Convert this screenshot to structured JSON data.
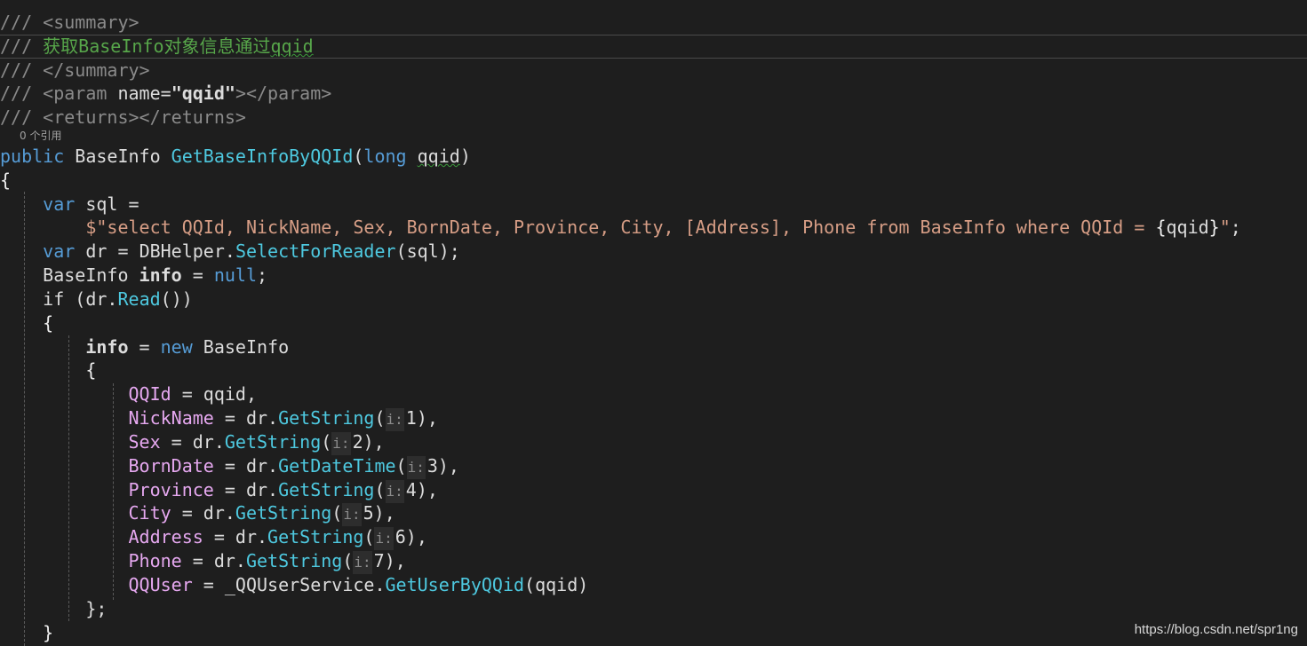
{
  "codelens": "0 个引用",
  "doc": {
    "slashes": "///",
    "summary_open": "<summary>",
    "summary_text": "获取BaseInfo对象信息通过",
    "summary_param_word": "qqid",
    "summary_close": "</summary>",
    "param_open": "<param",
    "param_attr": "name=",
    "param_value": "\"qqid\"",
    "param_close": "></param>",
    "returns": "<returns></returns>"
  },
  "signature": {
    "modifier": "public",
    "return_type": "BaseInfo",
    "method": "GetBaseInfoByQQId",
    "open": "(",
    "param_type": "long",
    "param_name": "qqid",
    "close": ")"
  },
  "body": {
    "open_brace": "{",
    "close_brace": "}",
    "var": "var",
    "sql_var": "sql",
    "assign": " = ",
    "dollar": "$",
    "sql_string": "\"select QQId, NickName, Sex, BornDate, Province, City, [Address], Phone from BaseInfo where QQId = ",
    "interp_open": "{",
    "interp_var": "qqid",
    "interp_close": "}",
    "sql_end_quote": "\"",
    "semicolon": ";",
    "dr_var": "dr",
    "dbhelper": "DBHelper",
    "dot": ".",
    "select_reader": "SelectForReader",
    "sql_arg": "(sql);",
    "baseinfo_type": "BaseInfo",
    "info_var": "info",
    "null_kw": "null",
    "if_kw": "if",
    "if_open": " (dr.",
    "read_method": "Read",
    "if_close": "())",
    "new_kw": "new",
    "init_close": "};",
    "hint_label": "i:",
    "assignments": [
      {
        "prop": "QQId",
        "value": "qqid,"
      },
      {
        "prop": "NickName",
        "method": "GetString",
        "arg": "1"
      },
      {
        "prop": "Sex",
        "method": "GetString",
        "arg": "2"
      },
      {
        "prop": "BornDate",
        "method": "GetDateTime",
        "arg": "3"
      },
      {
        "prop": "Province",
        "method": "GetString",
        "arg": "4"
      },
      {
        "prop": "City",
        "method": "GetString",
        "arg": "5"
      },
      {
        "prop": "Address",
        "method": "GetString",
        "arg": "6"
      },
      {
        "prop": "Phone",
        "method": "GetString",
        "arg": "7"
      }
    ],
    "qquser": {
      "prop": "QQUser",
      "service": "_QQUserService",
      "method": "GetUserByQQid",
      "arg": "(qqid)"
    }
  },
  "watermark": "https://blog.csdn.net/spr1ng"
}
